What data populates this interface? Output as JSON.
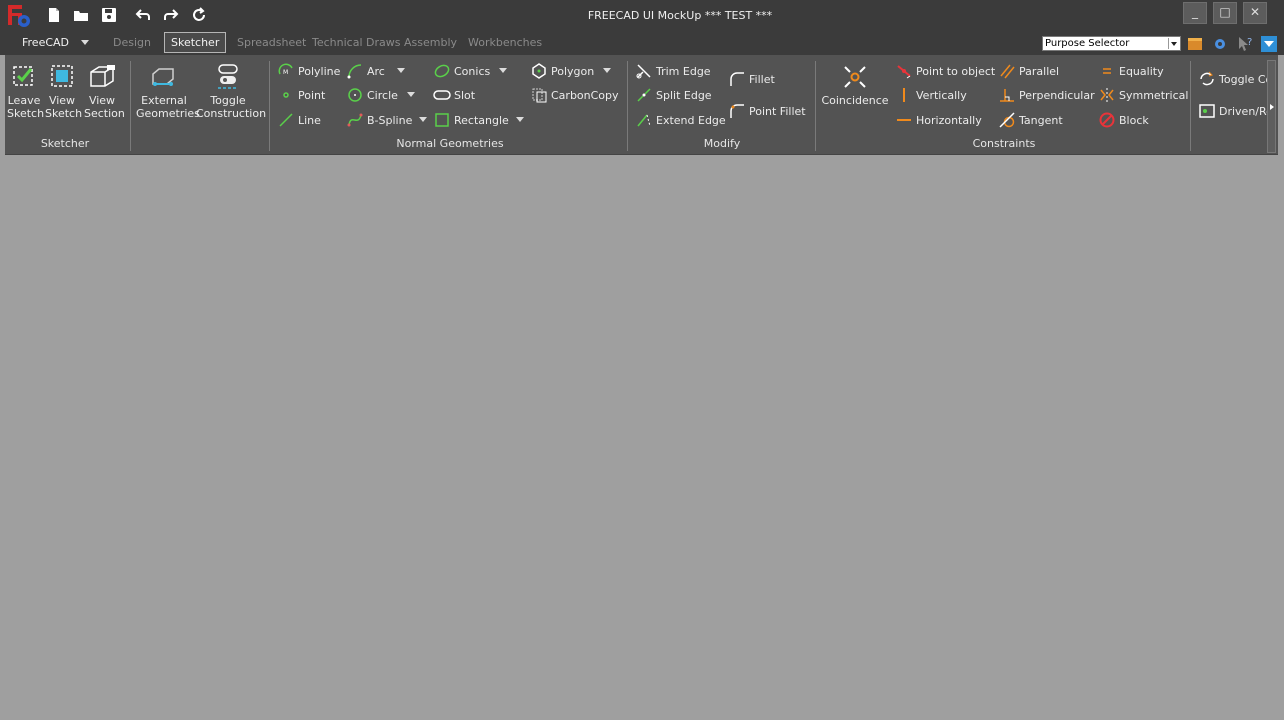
{
  "window": {
    "title": "FREECAD UI MockUp *** TEST ***",
    "minimize": "_",
    "maximize": "□",
    "close": "✕"
  },
  "tabs": {
    "app_menu": "FreeCAD",
    "items": [
      "Design",
      "Sketcher",
      "Spreadsheet",
      "Technical Draws",
      "Assembly",
      "Workbenches"
    ],
    "active": "Sketcher"
  },
  "purpose_selector": {
    "value": "Purpose Selector"
  },
  "ribbon": {
    "sketcher": {
      "group_label": "Sketcher",
      "leave": {
        "line1": "Leave",
        "line2": "Sketch"
      },
      "view_sketch": {
        "line1": "View",
        "line2": "Sketch"
      },
      "view_section": {
        "line1": "View",
        "line2": "Section"
      }
    },
    "external": {
      "external_geometries": {
        "line1": "External",
        "line2": "Geometries"
      },
      "toggle_construction": {
        "line1": "Toggle",
        "line2": "Construction"
      }
    },
    "geometries": {
      "group_label": "Normal Geometries",
      "polyline": "Polyline",
      "point": "Point",
      "line": "Line",
      "arc": "Arc",
      "circle": "Circle",
      "bspline": "B-Spline",
      "conics": "Conics",
      "slot": "Slot",
      "rectangle": "Rectangle",
      "polygon": "Polygon",
      "carboncopy": "CarbonCopy"
    },
    "modify": {
      "group_label": "Modify",
      "trim": "Trim Edge",
      "split": "Split Edge",
      "extend": "Extend Edge",
      "fillet": "Fillet",
      "point_fillet": "Point Fillet"
    },
    "constraints": {
      "group_label": "Constraints",
      "coincidence": "Coincidence",
      "point_on_object": "Point to object",
      "vertically": "Vertically",
      "horizontally": "Horizontally",
      "parallel": "Parallel",
      "perpendicular": "Perpendicular",
      "tangent": "Tangent",
      "equality": "Equality",
      "symmetrical": "Symmetrical",
      "block": "Block"
    },
    "overflow": {
      "toggle": "Toggle Cons",
      "driven": "Driven/Refer"
    }
  },
  "colors": {
    "accent": "#5ad04a",
    "cyan": "#3fb9e0",
    "constraint": "#f08a1c",
    "block": "#e8343a"
  }
}
